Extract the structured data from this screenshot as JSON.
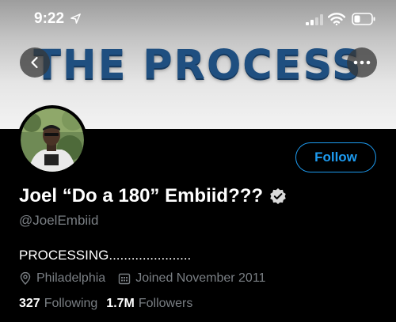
{
  "status_bar": {
    "time": "9:22",
    "icons": [
      "location-arrow-icon",
      "cellular-signal-icon",
      "wifi-icon",
      "battery-icon"
    ]
  },
  "banner": {
    "title": "THE PROCESS",
    "title_color": "#1f4f80"
  },
  "header_buttons": {
    "back_icon": "chevron-left-icon",
    "more_icon": "more-dots-icon"
  },
  "profile": {
    "display_name": "Joel “Do a 180” Embiid???",
    "verified": true,
    "handle": "@JoelEmbiid",
    "bio": "PROCESSING......................",
    "location": "Philadelphia",
    "joined": "Joined November 2011",
    "following_count": "327",
    "following_label": "Following",
    "followers_count": "1.7M",
    "followers_label": "Followers"
  },
  "actions": {
    "follow_label": "Follow"
  },
  "colors": {
    "accent": "#1d9bf0",
    "secondary_text": "#7a7f84",
    "background": "#000000"
  }
}
